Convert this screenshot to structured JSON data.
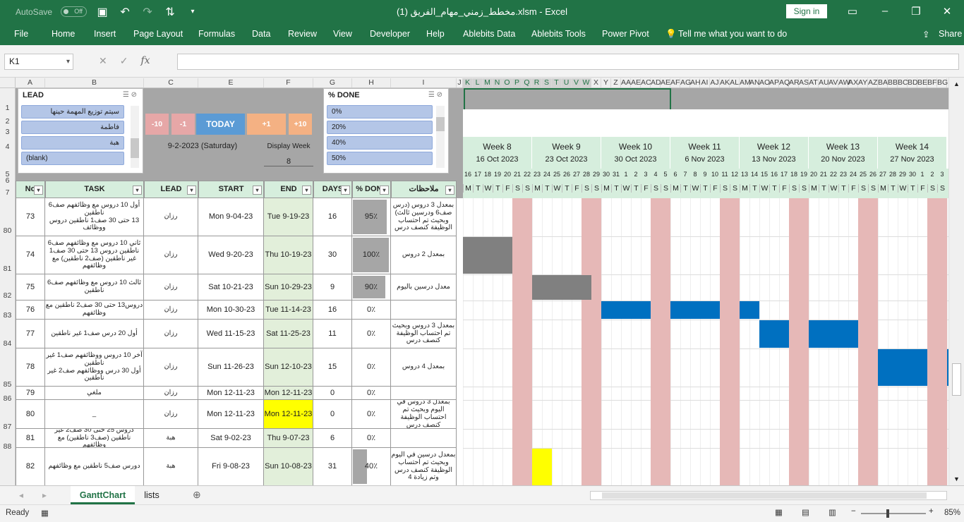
{
  "titlebar": {
    "autosave": "AutoSave",
    "toggle": "Off",
    "title": "مخطط_زمني_مهام_الفريق (1).xlsm  -  Excel",
    "signin": "Sign in"
  },
  "ribbon": {
    "tabs": [
      "File",
      "Home",
      "Insert",
      "Page Layout",
      "Formulas",
      "Data",
      "Review",
      "View",
      "Developer",
      "Help",
      "Ablebits Data",
      "Ablebits Tools",
      "Power Pivot"
    ],
    "tell": "Tell me what you want to do",
    "share": "Share"
  },
  "formula_bar": {
    "namebox": "K1",
    "fx": "fx",
    "content": ""
  },
  "columns": [
    "A",
    "B",
    "C",
    "E",
    "F",
    "G",
    "H",
    "I",
    "J",
    "K",
    "L",
    "M",
    "N",
    "O",
    "P",
    "Q",
    "R",
    "S",
    "T",
    "U",
    "V",
    "W",
    "X",
    "Y",
    "Z",
    "AA",
    "AE",
    "AC",
    "AD",
    "AE",
    "AF",
    "AG",
    "AH",
    "AI",
    "AJ",
    "AK",
    "AL",
    "AM",
    "AN",
    "AO",
    "AP",
    "AQ",
    "AR",
    "AS",
    "AT",
    "AU",
    "AV",
    "AW",
    "AX",
    "AY",
    "AZ",
    "BA",
    "BB",
    "BC",
    "BD",
    "BE",
    "BF",
    "BG"
  ],
  "row_numbers": [
    "1",
    "2",
    "3",
    "4",
    "5",
    "6",
    "7",
    "80",
    "81",
    "82",
    "83",
    "84",
    "85",
    "86",
    "87",
    "88"
  ],
  "slicer_lead": {
    "title": "LEAD",
    "items": [
      "سيتم توزيع المهمة حينها",
      "فاطمة",
      "هبة",
      "(blank)"
    ]
  },
  "slicer_done": {
    "title": "% DONE",
    "items": [
      "0%",
      "20%",
      "40%",
      "50%"
    ]
  },
  "nav": {
    "m10": "-10",
    "m1": "-1",
    "today": "TODAY",
    "p1": "+1",
    "p10": "+10",
    "date": "9-2-2023 (Saturday)",
    "display_week_label": "Display Week",
    "display_week": "8"
  },
  "headers": {
    "no": "No",
    "task": "TASK",
    "lead": "LEAD",
    "start": "START",
    "end": "END",
    "days": "DAYS",
    "done": "% DONE",
    "notes": "ملاحظات"
  },
  "rows": [
    {
      "no": "73",
      "task": "أول 10 دروس مع وظائفهم صف6 ناطقين\n13 حتى 30 صف1 ناطقين دروس ووظائف",
      "lead": "رزان",
      "start": "Mon 9-04-23",
      "end": "Tue 9-19-23",
      "days": "16",
      "done": "95٪",
      "notes": "بمعدل 3 دروس (درس صف6 ودرسين ثالث) وبحيث تم احتساب الوظيفة كنصف درس"
    },
    {
      "no": "74",
      "task": "ثاني 10 دروس مع وظائفهم صف6 ناطقين دروس 13 حتى 30 صف1 غير ناطقين (صف2 ناطقين) مع وظائفهم",
      "lead": "رزان",
      "start": "Wed 9-20-23",
      "end": "Thu 10-19-23",
      "days": "30",
      "done": "100٪",
      "notes": "بمعدل 2 دروس"
    },
    {
      "no": "75",
      "task": "ثالث 10 دروس مع وظائفهم صف6 ناطقين",
      "lead": "رزان",
      "start": "Sat 10-21-23",
      "end": "Sun 10-29-23",
      "days": "9",
      "done": "90٪",
      "notes": "معدل درسين باليوم"
    },
    {
      "no": "76",
      "task": "دروس13 حتى 30 صف2 ناطقين مع وظائفهم",
      "lead": "رزان",
      "start": "Mon 10-30-23",
      "end": "Tue 11-14-23",
      "days": "16",
      "done": "0٪",
      "notes": ""
    },
    {
      "no": "77",
      "task": "أول 20 درس صف1 غير ناطقين",
      "lead": "رزان",
      "start": "Wed 11-15-23",
      "end": "Sat 11-25-23",
      "days": "11",
      "done": "0٪",
      "notes": "بمعدل 3 دروس وبحيث تم احتساب الوظيفة كنصف درس"
    },
    {
      "no": "78",
      "task": "آخر 10 دروس ووظائفهم صف1 غير ناطقين\nأول 30 درس ووظائفهم صف2 غير ناطقين",
      "lead": "رزان",
      "start": "Sun 11-26-23",
      "end": "Sun 12-10-23",
      "days": "15",
      "done": "0٪",
      "notes": "بمعدل 4 دروس"
    },
    {
      "no": "79",
      "task": "ملغي",
      "lead": "رزان",
      "start": "Mon 12-11-23",
      "end": "Mon 12-11-23",
      "days": "0",
      "done": "0٪",
      "notes": ""
    },
    {
      "no": "80",
      "task": "_",
      "lead": "رزان",
      "start": "Mon 12-11-23",
      "end": "Mon 12-11-23",
      "days": "0",
      "done": "0٪",
      "notes": "بمعدل 3 دروس في اليوم وبحيث تم احتساب الوظيفة كنصف درس"
    },
    {
      "no": "81",
      "task": "دروس 25 حتى 30 صف2 غير ناطقين (صف3 ناطقين) مع وظائفهم",
      "lead": "هبة",
      "start": "Sat 9-02-23",
      "end": "Thu 9-07-23",
      "days": "6",
      "done": "0٪",
      "notes": ""
    },
    {
      "no": "82",
      "task": "دورس صف5 ناطقين مع وظائفهم",
      "lead": "هبة",
      "start": "Fri 9-08-23",
      "end": "Sun 10-08-23",
      "days": "31",
      "done": "40٪",
      "notes": "بمعدل درسين في اليوم وبحيث تم احتساب الوظيفة كنصف درس وتم زيادة 4"
    }
  ],
  "weeks": [
    {
      "label": "Week 8",
      "date": "16 Oct 2023"
    },
    {
      "label": "Week 9",
      "date": "23 Oct 2023"
    },
    {
      "label": "Week 10",
      "date": "30 Oct 2023"
    },
    {
      "label": "Week 11",
      "date": "6 Nov 2023"
    },
    {
      "label": "Week 12",
      "date": "13 Nov 2023"
    },
    {
      "label": "Week 13",
      "date": "20 Nov 2023"
    },
    {
      "label": "Week 14",
      "date": "27 Nov 2023"
    }
  ],
  "day_numbers": [
    "16",
    "17",
    "18",
    "19",
    "20",
    "21",
    "22",
    "23",
    "24",
    "25",
    "26",
    "27",
    "28",
    "29",
    "30",
    "31",
    "1",
    "2",
    "3",
    "4",
    "5",
    "6",
    "7",
    "8",
    "9",
    "10",
    "11",
    "12",
    "13",
    "14",
    "15",
    "16",
    "17",
    "18",
    "19",
    "20",
    "21",
    "22",
    "23",
    "24",
    "25",
    "26",
    "27",
    "28",
    "29",
    "30",
    "1",
    "2",
    "3"
  ],
  "day_letters": [
    "M",
    "T",
    "W",
    "T",
    "F",
    "S",
    "S"
  ],
  "colors": {
    "excel_green": "#217346",
    "header_green": "#d6eedd",
    "gantt_blue": "#0070c0",
    "done_grey": "#808080",
    "weekend": "#e6b8b7",
    "highlight": "#ffff00"
  },
  "sheet_tabs": [
    "GanttChart",
    "lists"
  ],
  "status": {
    "ready": "Ready",
    "zoom": "85%"
  }
}
